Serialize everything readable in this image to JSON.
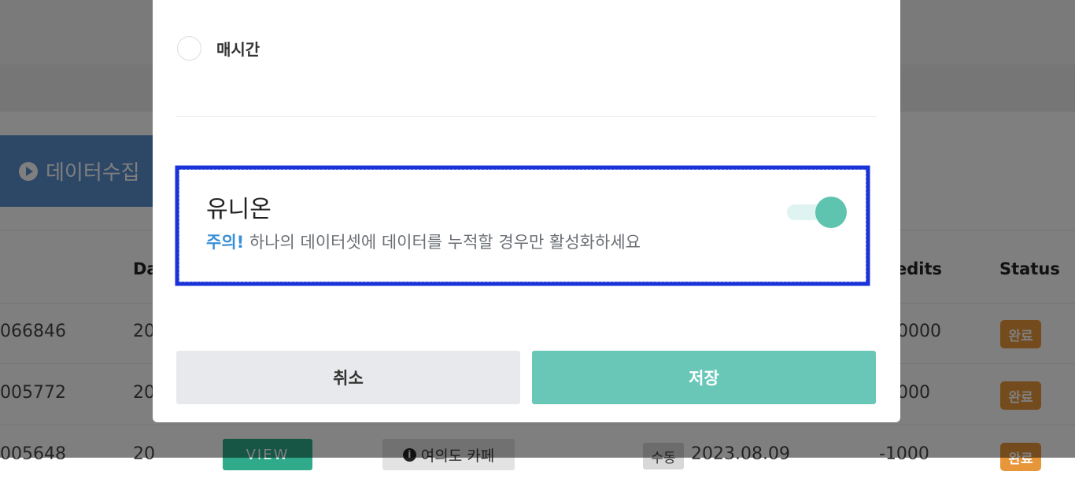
{
  "background": {
    "collect_button": {
      "label": "데이터수집"
    },
    "table": {
      "headers": [
        {
          "label": "Da"
        },
        {
          "label": "edits"
        },
        {
          "label": "Status"
        }
      ],
      "rows": [
        {
          "id": "066846",
          "date": "20",
          "credits": "0000",
          "status": "완료"
        },
        {
          "id": "005772",
          "date": "20",
          "credits": "000",
          "status": "완료"
        },
        {
          "id": "005648",
          "date": "20",
          "view": "VIEW",
          "place": "여의도 카페",
          "mode": "수동",
          "timestamp": "2023.08.09",
          "credits": "-1000",
          "status": "완료"
        }
      ]
    }
  },
  "modal": {
    "schedule_option": {
      "label": "매시간",
      "selected": false
    },
    "union": {
      "title": "유니온",
      "warning_label": "주의!",
      "description": "하나의 데이터셋에 데이터를 누적할 경우만 활성화하세요",
      "enabled": true
    },
    "buttons": {
      "cancel": "취소",
      "save": "저장"
    }
  },
  "colors": {
    "accent": "#69c7b8",
    "toggle_on": "#5ec4b0",
    "warning": "#3a8fd6",
    "badge": "#e8963a",
    "highlight": "#1a33d9"
  }
}
